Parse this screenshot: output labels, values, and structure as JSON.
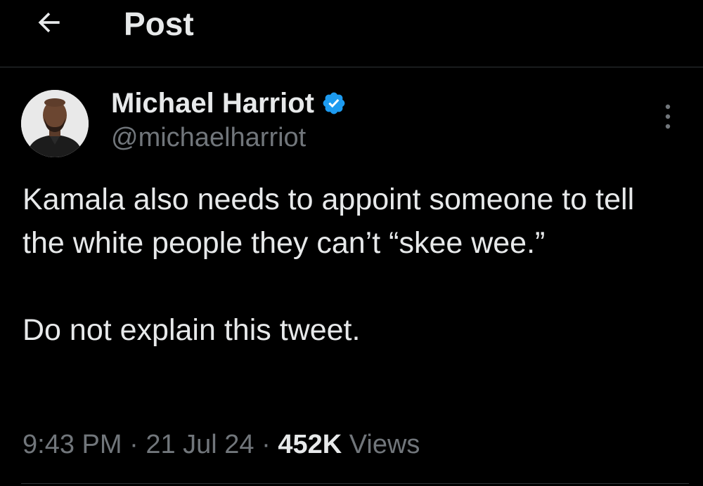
{
  "header": {
    "back_icon": "arrow-left-icon",
    "title": "Post"
  },
  "author": {
    "name": "Michael Harriot",
    "handle": "@michaelharriot",
    "verified": true,
    "verified_color": "#1d9bf0",
    "avatar": "profile-photo"
  },
  "more_icon": "more-vertical-icon",
  "tweet": {
    "paragraphs": [
      "Kamala also needs to appoint someone to tell the white people they can’t “skee wee.”",
      "Do not explain this tweet."
    ]
  },
  "meta": {
    "time": "9:43 PM",
    "separator": "·",
    "date": "21 Jul 24",
    "views_count": "452K",
    "views_label": "Views"
  },
  "colors": {
    "background": "#000000",
    "primary_text": "#e7e9ea",
    "secondary_text": "#71767b",
    "divider": "#2f3336"
  }
}
